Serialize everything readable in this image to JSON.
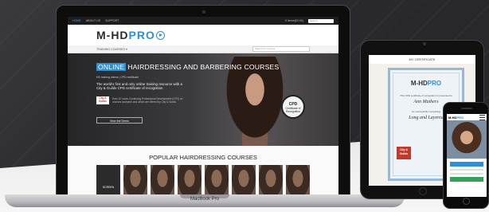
{
  "site": {
    "topbar": {
      "links": [
        "HOME",
        "ABOUT US",
        "SUPPORT"
      ],
      "basket": "0 Items(£0.00)",
      "search_placeholder": "Search"
    },
    "logo": {
      "main": "M-HD",
      "accent": "PRO"
    },
    "nav": {
      "menu_label": "TRAINING COURSES ▾",
      "search_placeholder": "Search for courses..."
    },
    "hero": {
      "title_highlight": "ONLINE",
      "title_rest": "HAIRDRESSING AND BARBERING COURSES",
      "meta": "HD training videos  |  CPD certificate",
      "text": "The world's first and only online training resource with a City & Guilds CPD certificate of recognition",
      "cg_badge": "City & Guilds",
      "cg_text": "Earn 10 hours Continuing Professional Development (CPD) on courses accepted and which are offered by City & Guilds",
      "button": "View the Demo",
      "seal_top": "CPD",
      "seal_text": "Certificate of Recognition"
    },
    "courses": {
      "title": "POPULAR HAIRDRESSING COURSES",
      "first_label": "SCREEN"
    }
  },
  "laptop": {
    "model_label": "MacBook Pro"
  },
  "tablet": {
    "header": "MY CERTIFICATE",
    "cert_logo_main": "M-HD",
    "cert_logo_accent": "PRO",
    "cert_line1": "This CPD certificate of recognition is presented to",
    "cert_name1": "Ann Mathers",
    "cert_line2": "for successfully completing",
    "cert_name2": "Long and Layered",
    "cg_badge": "City & Guilds"
  },
  "phone": {
    "logo_main": "M-HD",
    "logo_accent": "PRO"
  },
  "colors": {
    "accent": "#2d8fd5",
    "cg_red": "#c0392b",
    "phone_green": "#35a05a"
  }
}
